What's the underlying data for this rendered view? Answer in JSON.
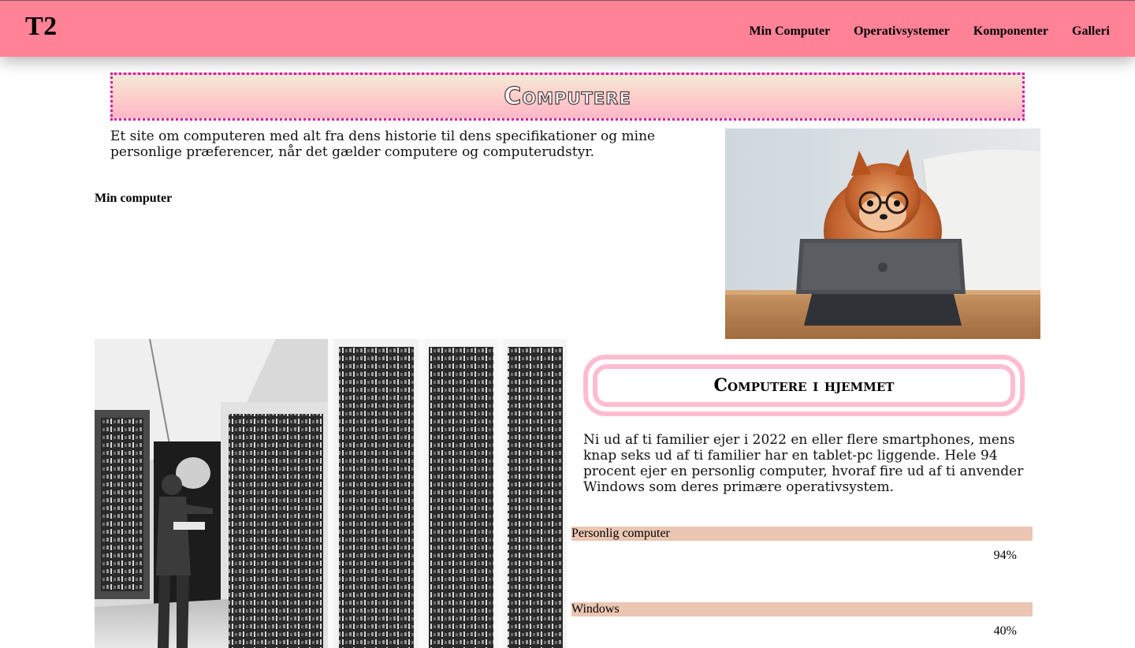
{
  "header": {
    "logo": "T2",
    "nav": [
      "Min Computer",
      "Operativsystemer",
      "Komponenter",
      "Galleri"
    ]
  },
  "hero": {
    "title": "Computere",
    "intro": "Et site om computeren med alt fra dens historie til dens specifikationer og mine personlige præferencer, når det gælder computere og computerudstyr."
  },
  "sections": {
    "min_computer_label": "Min computer"
  },
  "home": {
    "title": "Computere i hjemmet",
    "text": "Ni ud af ti familier ejer i 2022 en eller flere smartphones, mens knap seks ud af ti familier har en tablet-pc liggende. Hele 94 procent ejer en personlig computer, hvoraf fire ud af ti anvender Windows som deres primære operativsystem."
  },
  "stats": [
    {
      "label": "Personlig computer",
      "value_text": "94%",
      "value": 94
    },
    {
      "label": "Windows",
      "value_text": "40%",
      "value": 40
    }
  ],
  "colors": {
    "header": "#ff8297",
    "hero_border": "#d21aa8",
    "home_border": "#ffbcd0",
    "bar": "#ebc6b3"
  }
}
